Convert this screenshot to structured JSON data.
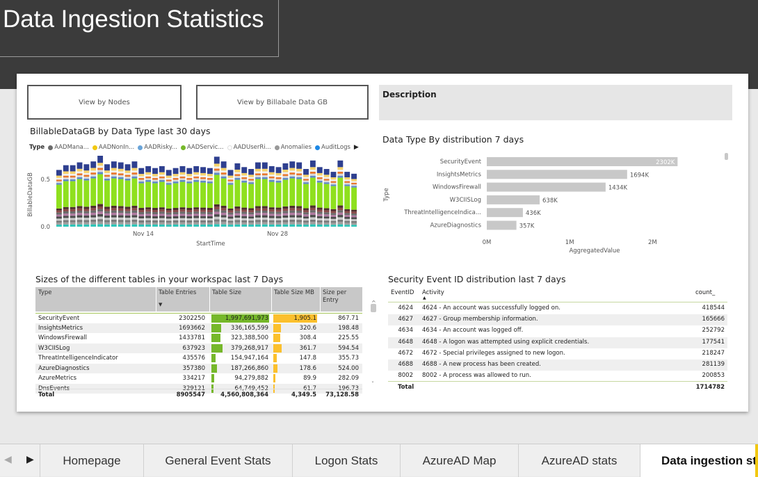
{
  "page_title": "Data Ingestion Statistics",
  "nav_buttons": {
    "nodes": "View by Nodes",
    "billable": "View by Billabale Data GB"
  },
  "description": {
    "title": "Description"
  },
  "billable_chart": {
    "title": "BillableDataGB by Data Type last 30 days",
    "legend_label": "Type",
    "legend": [
      {
        "name": "AADMana...",
        "color": "#6b6b6b"
      },
      {
        "name": "AADNonIn...",
        "color": "#f2c811"
      },
      {
        "name": "AADRisky...",
        "color": "#6aa4d8"
      },
      {
        "name": "AADServic...",
        "color": "#76b82a"
      },
      {
        "name": "AADUserRi...",
        "color": "#ffffff"
      },
      {
        "name": "Anomalies",
        "color": "#999999"
      },
      {
        "name": "AuditLogs",
        "color": "#1e88e5"
      }
    ],
    "legend_more_icon": "play-right-icon"
  },
  "distribution_chart": {
    "title": "Data Type By distribution 7 days"
  },
  "tables_table": {
    "title": "Sizes of the different tables in your workspac last 7 Days",
    "headers": [
      "Type",
      "Table Entries",
      "Table Size",
      "Table Size MB",
      "Size per Entry"
    ],
    "sort_icon": "sort-down-icon",
    "rows": [
      {
        "type": "SecurityEvent",
        "entries": "2302250",
        "size": "1,997,691,973",
        "mb": "1,905.1",
        "per": "867.71",
        "size_frac": 1.0,
        "mb_frac": 1.0
      },
      {
        "type": "InsightsMetrics",
        "entries": "1693662",
        "size": "336,165,599",
        "mb": "320.6",
        "per": "198.48",
        "size_frac": 0.168,
        "mb_frac": 0.168
      },
      {
        "type": "WindowsFirewall",
        "entries": "1433781",
        "size": "323,388,500",
        "mb": "308.4",
        "per": "225.55",
        "size_frac": 0.162,
        "mb_frac": 0.162
      },
      {
        "type": "W3CIISLog",
        "entries": "637923",
        "size": "379,268,917",
        "mb": "361.7",
        "per": "594.54",
        "size_frac": 0.19,
        "mb_frac": 0.19
      },
      {
        "type": "ThreatIntelligenceIndicator",
        "entries": "435576",
        "size": "154,947,164",
        "mb": "147.8",
        "per": "355.73",
        "size_frac": 0.078,
        "mb_frac": 0.078
      },
      {
        "type": "AzureDiagnostics",
        "entries": "357380",
        "size": "187,266,860",
        "mb": "178.6",
        "per": "524.00",
        "size_frac": 0.094,
        "mb_frac": 0.094
      },
      {
        "type": "AzureMetrics",
        "entries": "334217",
        "size": "94,279,882",
        "mb": "89.9",
        "per": "282.09",
        "size_frac": 0.047,
        "mb_frac": 0.047
      },
      {
        "type": "DnsEvents",
        "entries": "329121",
        "size": "64,749,452",
        "mb": "61.7",
        "per": "196.73",
        "size_frac": 0.032,
        "mb_frac": 0.032
      }
    ],
    "total": {
      "label": "Total",
      "entries": "8905547",
      "size": "4,560,808,364",
      "mb": "4,349.5",
      "per": "73,128.58"
    }
  },
  "security_table": {
    "title": "Security Event ID distribution last 7 days",
    "headers": [
      "EventID",
      "Activity",
      "count_"
    ],
    "sort_icon": "sort-up-icon",
    "rows": [
      {
        "id": "4624",
        "activity": "4624 - An account was successfully logged on.",
        "count": "418544"
      },
      {
        "id": "4627",
        "activity": "4627 - Group membership information.",
        "count": "165666"
      },
      {
        "id": "4634",
        "activity": "4634 - An account was logged off.",
        "count": "252792"
      },
      {
        "id": "4648",
        "activity": "4648 - A logon was attempted using explicit credentials.",
        "count": "177541"
      },
      {
        "id": "4672",
        "activity": "4672 - Special privileges assigned to new logon.",
        "count": "218247"
      },
      {
        "id": "4688",
        "activity": "4688 - A new process has been created.",
        "count": "281139"
      },
      {
        "id": "8002",
        "activity": "8002 - A process was allowed to run.",
        "count": "200853"
      }
    ],
    "total": {
      "label": "Total",
      "count": "1714782"
    }
  },
  "tabs": {
    "prev_icon": "chevron-left-icon",
    "next_icon": "chevron-right-icon",
    "items": [
      "Homepage",
      "General Event Stats",
      "Logon Stats",
      "AzureAD Map",
      "AzureAD stats",
      "Data ingestion stats"
    ],
    "active_index": 5
  },
  "chart_data": [
    {
      "type": "bar",
      "subtype": "stacked",
      "title": "BillableDataGB by Data Type last 30 days",
      "xlabel": "StartTime",
      "ylabel": "BillableDataGB",
      "x_ticks": [
        "Nov 14",
        "Nov 28"
      ],
      "y_ticks": [
        "0.0",
        "0.5"
      ],
      "ylim": [
        0,
        0.75
      ],
      "legend_position": "top",
      "totals": [
        0.6,
        0.65,
        0.65,
        0.68,
        0.66,
        0.69,
        0.75,
        0.66,
        0.69,
        0.68,
        0.66,
        0.69,
        0.62,
        0.64,
        0.62,
        0.64,
        0.6,
        0.62,
        0.64,
        0.62,
        0.64,
        0.63,
        0.62,
        0.74,
        0.69,
        0.6,
        0.67,
        0.63,
        0.61,
        0.68,
        0.68,
        0.64,
        0.63,
        0.67,
        0.69,
        0.68,
        0.61,
        0.7,
        0.63,
        0.61,
        0.58,
        0.7,
        0.58,
        0.56
      ],
      "series": [
        {
          "name": "AADServic...",
          "color": "#8fe01e",
          "fraction": 0.42
        },
        {
          "name": "AADNonIn...",
          "color": "#f5d36b",
          "fraction": 0.1
        },
        {
          "name": "AuditLogs",
          "color": "#2e3f8f",
          "fraction": 0.1
        }
      ]
    },
    {
      "type": "bar",
      "orientation": "horizontal",
      "title": "Data Type By distribution 7 days",
      "xlabel": "AggregatedValue",
      "ylabel": "Type",
      "categories": [
        "SecurityEvent",
        "InsightsMetrics",
        "WindowsFirewall",
        "W3CIISLog",
        "ThreatIntelligenceIndica...",
        "AzureDiagnostics"
      ],
      "values": [
        2302250,
        1693662,
        1433781,
        637923,
        435576,
        357380
      ],
      "data_labels": [
        "2302K",
        "1694K",
        "1434K",
        "638K",
        "436K",
        "357K"
      ],
      "x_ticks": [
        "0M",
        "1M",
        "2M"
      ],
      "xlim": [
        0,
        2400000
      ]
    }
  ]
}
